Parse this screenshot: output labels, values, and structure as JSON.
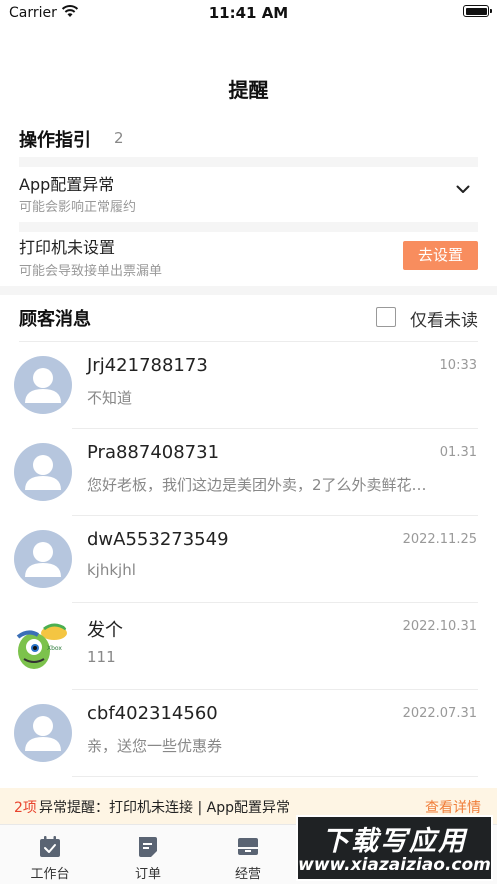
{
  "status_bar": {
    "carrier": "Carrier",
    "time": "11:41 AM"
  },
  "page": {
    "title": "提醒"
  },
  "operations": {
    "header": "操作指引",
    "count": "2",
    "items": [
      {
        "title": "App配置异常",
        "desc": "可能会影响正常履约"
      },
      {
        "title": "打印机未设置",
        "desc": "可能会导致接单出票漏单",
        "action": "去设置"
      }
    ]
  },
  "messages": {
    "header": "顾客消息",
    "unread_only_label": "仅看未读",
    "items": [
      {
        "name": "Jrj421788173",
        "time": "10:33",
        "preview": "不知道"
      },
      {
        "name": "Pra887408731",
        "time": "01.31",
        "preview": "您好老板，我们这边是美团外卖，2了么外卖鲜花…"
      },
      {
        "name": "dwA553273549",
        "time": "2022.11.25",
        "preview": "kjhkjhl"
      },
      {
        "name": "发个",
        "time": "2022.10.31",
        "preview": "111"
      },
      {
        "name": "cbf402314560",
        "time": "2022.07.31",
        "preview": "亲，送您一些优惠券"
      }
    ]
  },
  "alert": {
    "count": "2项",
    "text": "异常提醒：打印机未连接 | App配置异常",
    "detail": "查看详情"
  },
  "tabbar": {
    "items": [
      {
        "label": "工作台",
        "icon": "workbench-icon"
      },
      {
        "label": "订单",
        "icon": "order-icon"
      },
      {
        "label": "经营",
        "icon": "business-icon"
      }
    ]
  },
  "watermark": {
    "title": "下载写应用",
    "url": "www.xiazaiziao.com"
  }
}
